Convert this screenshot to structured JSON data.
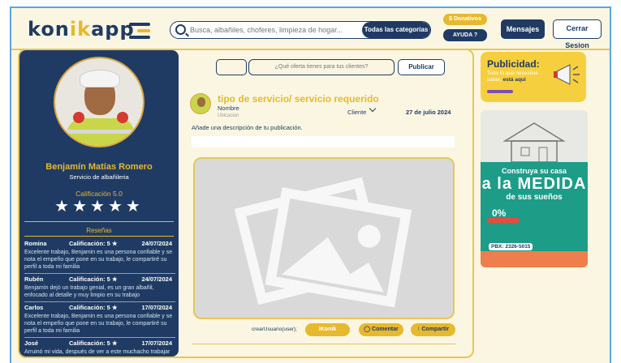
{
  "header": {
    "logo_part1": "kon",
    "logo_part2": "ik",
    "logo_part3": "app",
    "search_placeholder": "Busca, albañiles, choferes, limpieza de hogar...",
    "categories_label": "Todas las categorias",
    "donate_label": "$ Donativos",
    "help_label": "AYUDA ?",
    "messages_label": "Mensajes",
    "logout_label": "Cerrar Sesion"
  },
  "profile": {
    "name": "Benjamín Matías Romero",
    "service": "Servicio de albañileria",
    "rating_label": "Calificación 5.0",
    "stars": "★★★★★",
    "reviews_title": "Reseñas",
    "reviews": [
      {
        "name": "Romina",
        "rating": "Calificación: 5 ★",
        "date": "24/07/2024",
        "text": "Excelente trabajo, Benjamin es una persona confiable y se nota el empeño que pone en su trabajo, le compartiré su perfil a toda mi familia"
      },
      {
        "name": "Rubén",
        "rating": "Calificación: 5 ★",
        "date": "24/07/2024",
        "text": "Benjamín dejó un trabajo genial, es un gran albañil, enfocado al detalle y muy limpio en su trabajo"
      },
      {
        "name": "Carlos",
        "rating": "Calificación: 5 ★",
        "date": "17/07/2024",
        "text": "Excelente trabajo, Benjamin es una persona confiable y se nota el empeño que pone en su trabajo, le compartiré su perfil a toda mi familia"
      },
      {
        "name": "José",
        "rating": "Calificación: 5 ★",
        "date": "17/07/2024",
        "text": "Arruinó mi vida, después de ver a este muchacho trabajar no encontraré nada que me de alegria"
      }
    ]
  },
  "composer": {
    "offer_placeholder": "¿Qué oferta tienes para tus clientes?",
    "publish_label": "Publicar"
  },
  "post": {
    "title": "tipo de servicio/ servicio requerido",
    "name_label": "Nombre",
    "location_label": "Ubicacion",
    "client_label": "Cliente",
    "date": "27 de julio 2024",
    "description_prompt": "Añade una descripción de tu publicación.",
    "creator_text": "crearUsuario(user);",
    "ikonik_label": "iKonik",
    "comment_label": "Comentar",
    "share_label": "Compartir"
  },
  "ads": {
    "ad1_title": "Publicidad:",
    "ad1_text": "Todo lo que necesitas saber,",
    "ad1_bold": "está aquí",
    "ad2_line1": "Construya su casa",
    "ad2_line2": "a la MEDIDA",
    "ad2_line3": "de sus sueños",
    "ad2_pct": "0%",
    "ad2_phone": "PBX: 2326-5015"
  }
}
